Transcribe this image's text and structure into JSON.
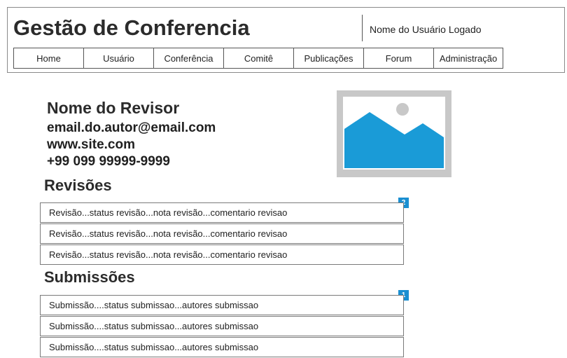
{
  "header": {
    "title": "Gestão de Conferencia",
    "user_name": "Nome do Usuário Logado"
  },
  "nav": {
    "items": [
      {
        "label": "Home"
      },
      {
        "label": "Usuário"
      },
      {
        "label": "Conferência"
      },
      {
        "label": "Comitê"
      },
      {
        "label": "Publicações"
      },
      {
        "label": "Forum"
      },
      {
        "label": "Administração"
      }
    ]
  },
  "profile": {
    "name": "Nome do Revisor",
    "email": "email.do.autor@email.com",
    "site": "www.site.com",
    "phone": "+99 099 99999-9999",
    "photo_icon": "image-placeholder-icon"
  },
  "reviews": {
    "title": "Revisões",
    "badge": "2",
    "items": [
      "Revisão...status revisão...nota revisão...comentario revisao",
      "Revisão...status revisão...nota revisão...comentario revisao",
      "Revisão...status revisão...nota revisão...comentario revisao"
    ]
  },
  "submissions": {
    "title": "Submissões",
    "badge": "1",
    "items": [
      "Submissão....status submissao...autores submissao",
      "Submissão....status submissao...autores submissao",
      "Submissão....status submissao...autores submissao"
    ]
  },
  "colors": {
    "accent": "#1a8fd1",
    "image_bg": "#c8c8c8",
    "border": "#7a7a7a"
  }
}
